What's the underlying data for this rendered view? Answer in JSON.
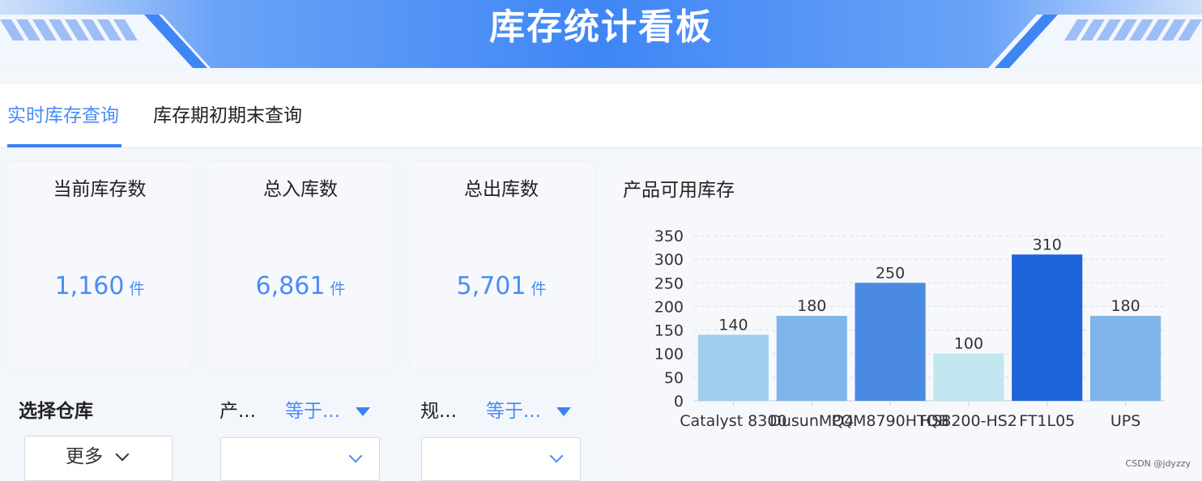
{
  "header": {
    "title": "库存统计看板"
  },
  "tabs": [
    {
      "label": "实时库存查询",
      "active": true
    },
    {
      "label": "库存期初期末查询",
      "active": false
    }
  ],
  "stats": [
    {
      "title": "当前库存数",
      "value": "1,160",
      "unit": "件"
    },
    {
      "title": "总入库数",
      "value": "6,861",
      "unit": "件"
    },
    {
      "title": "总出库数",
      "value": "5,701",
      "unit": "件"
    }
  ],
  "filters": {
    "warehouse": {
      "label": "选择仓库",
      "value": "更多"
    },
    "product": {
      "label": "产...",
      "operator": "等于..."
    },
    "spec": {
      "label": "规...",
      "operator": "等于..."
    }
  },
  "chart_data": {
    "type": "bar",
    "title": "产品可用库存",
    "categories": [
      "Catalyst 8300",
      "DusunMQ4",
      "PQM8790HTQB",
      "HS8200-HS2",
      "FT1L05",
      "UPS"
    ],
    "values": [
      140,
      180,
      250,
      100,
      310,
      180
    ],
    "colors": [
      "#9fcdec",
      "#7fb4e8",
      "#4a8ae3",
      "#c3e7f1",
      "#1f63db",
      "#80b4e8"
    ],
    "ylim": [
      0,
      350
    ],
    "yticks": [
      0,
      50,
      100,
      150,
      200,
      250,
      300,
      350
    ],
    "grid": true,
    "xlabel": "",
    "ylabel": ""
  },
  "colors": {
    "accent": "#4a8cf7",
    "banner": "#3f86f5"
  },
  "watermark": "CSDN @jdyzzy"
}
